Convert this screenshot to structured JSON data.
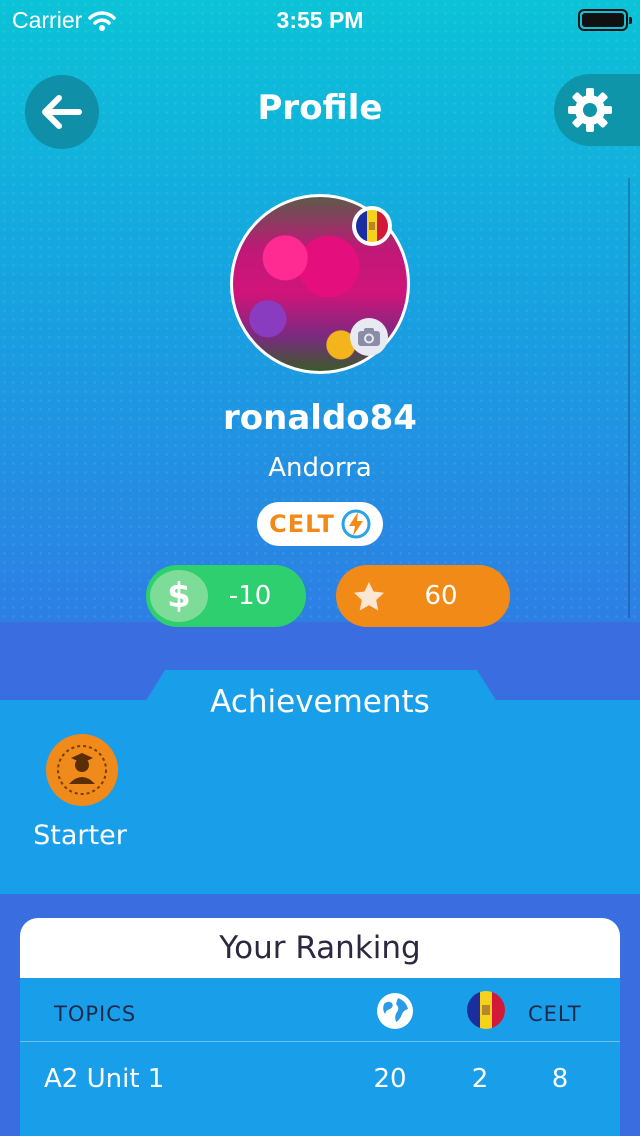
{
  "status_bar": {
    "carrier": "Carrier",
    "time": "3:55 PM"
  },
  "header": {
    "title": "Profile",
    "back_icon": "arrow-left-icon",
    "settings_icon": "gear-icon"
  },
  "profile": {
    "username": "ronaldo84",
    "country": "Andorra",
    "level_badge": "CELT",
    "coins": "-10",
    "stars": "60"
  },
  "achievements": {
    "title": "Achievements",
    "items": [
      {
        "label": "Starter",
        "icon": "graduate-medal-icon"
      }
    ]
  },
  "ranking": {
    "title": "Your Ranking",
    "columns": {
      "topics": "TOPICS",
      "world_icon": "globe-icon",
      "country_icon": "andorra-flag-icon",
      "celt": "CELT"
    },
    "rows": [
      {
        "topic": "A2 Unit 1",
        "world": "20",
        "country": "2",
        "celt": "8"
      }
    ]
  },
  "colors": {
    "coins": "#2ecf6e",
    "stars": "#f28a18",
    "card_bg": "#199eea",
    "page_bg": "#3a6de0"
  }
}
